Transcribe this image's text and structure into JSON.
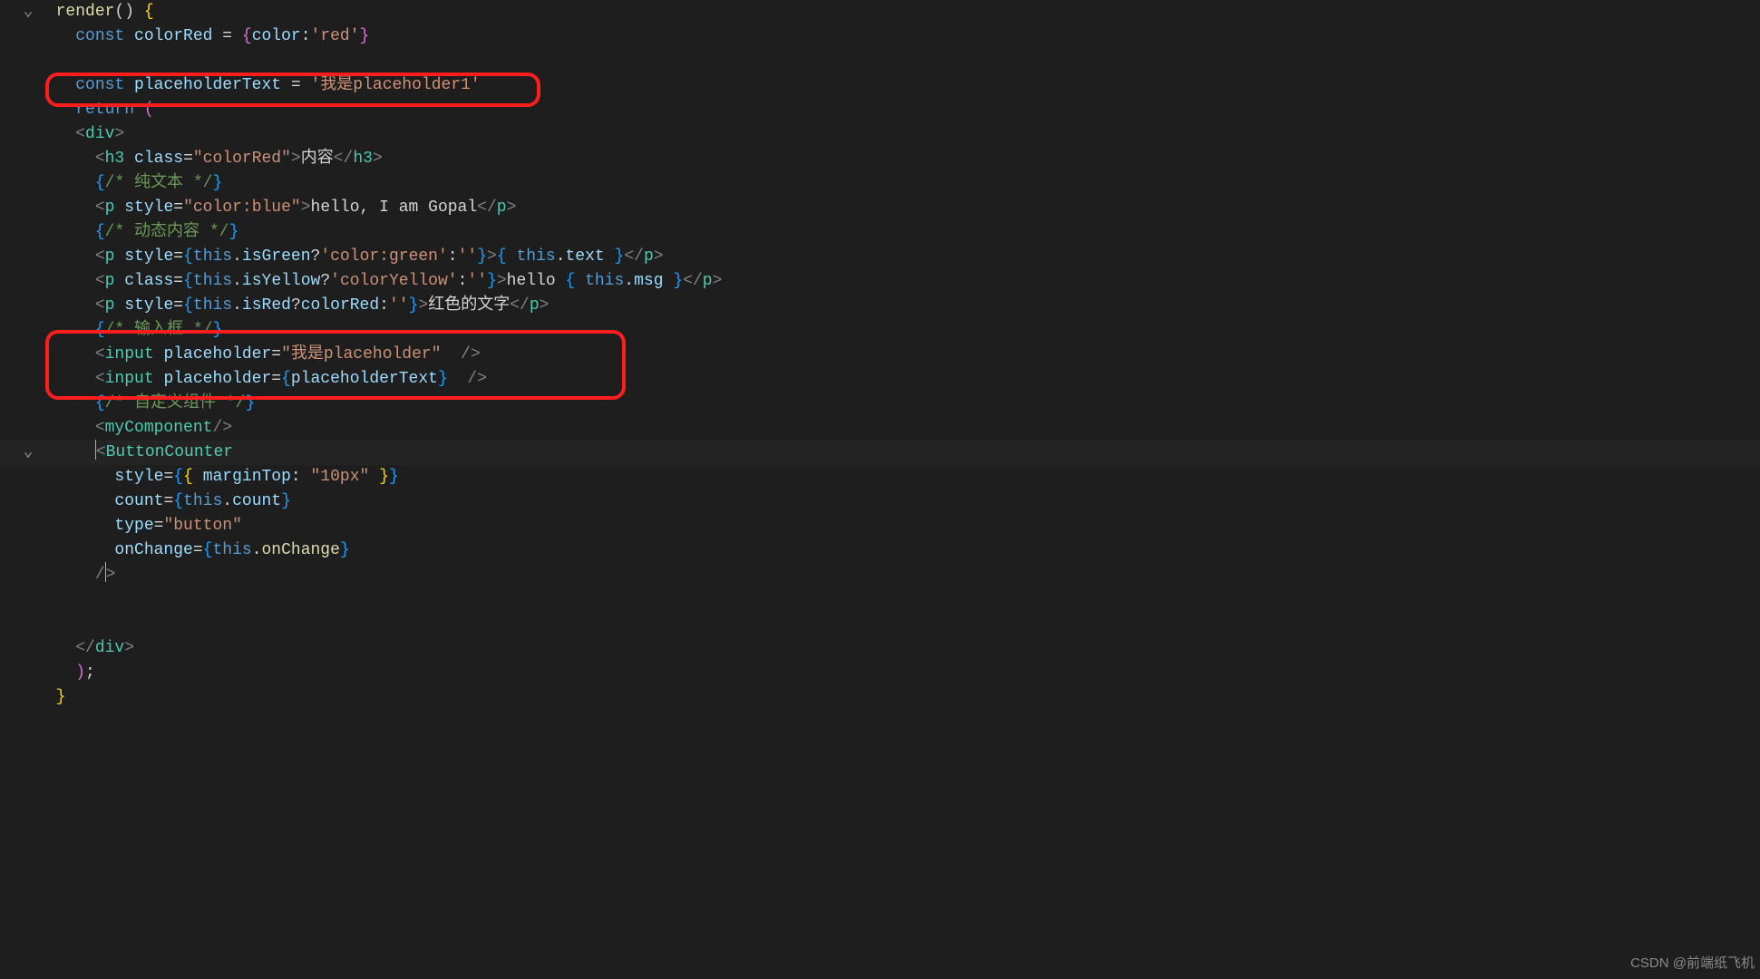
{
  "watermark": "CSDN @前端纸飞机",
  "fold_glyph": "⌄",
  "lines": [
    {
      "fold": true,
      "tokens": [
        [
          "ind",
          "  "
        ],
        [
          "fn",
          "render"
        ],
        [
          "pun",
          "() "
        ],
        [
          "br",
          "{"
        ]
      ]
    },
    {
      "tokens": [
        [
          "ind",
          "    "
        ],
        [
          "kw",
          "const"
        ],
        [
          "pun",
          " "
        ],
        [
          "var",
          "colorRed"
        ],
        [
          "pun",
          " = "
        ],
        [
          "br-p",
          "{"
        ],
        [
          "var",
          "color"
        ],
        [
          "pun",
          ":"
        ],
        [
          "str",
          "'red'"
        ],
        [
          "br-p",
          "}"
        ]
      ]
    },
    {
      "tokens": [
        [
          "pun",
          " "
        ]
      ]
    },
    {
      "tokens": [
        [
          "ind",
          "    "
        ],
        [
          "kw",
          "const"
        ],
        [
          "pun",
          " "
        ],
        [
          "var",
          "placeholderText"
        ],
        [
          "pun",
          " = "
        ],
        [
          "str",
          "'我是placeholder1'"
        ]
      ]
    },
    {
      "tokens": [
        [
          "ind",
          "    "
        ],
        [
          "kw",
          "return"
        ],
        [
          "pun",
          " "
        ],
        [
          "br-p",
          "("
        ]
      ]
    },
    {
      "tokens": [
        [
          "ind",
          "    "
        ],
        [
          "fade",
          "<"
        ],
        [
          "tag",
          "div"
        ],
        [
          "fade",
          ">"
        ]
      ]
    },
    {
      "tokens": [
        [
          "ind",
          "      "
        ],
        [
          "fade",
          "<"
        ],
        [
          "tag",
          "h3"
        ],
        [
          "pun",
          " "
        ],
        [
          "attr",
          "class"
        ],
        [
          "pun",
          "="
        ],
        [
          "str",
          "\"colorRed\""
        ],
        [
          "fade",
          ">"
        ],
        [
          "pun",
          "内容"
        ],
        [
          "fade",
          "</"
        ],
        [
          "tag",
          "h3"
        ],
        [
          "fade",
          ">"
        ]
      ]
    },
    {
      "tokens": [
        [
          "ind",
          "      "
        ],
        [
          "br-b",
          "{"
        ],
        [
          "cmt",
          "/* 纯文本 */"
        ],
        [
          "br-b",
          "}"
        ]
      ]
    },
    {
      "tokens": [
        [
          "ind",
          "      "
        ],
        [
          "fade",
          "<"
        ],
        [
          "tag",
          "p"
        ],
        [
          "pun",
          " "
        ],
        [
          "attr",
          "style"
        ],
        [
          "pun",
          "="
        ],
        [
          "str",
          "\"color:blue\""
        ],
        [
          "fade",
          ">"
        ],
        [
          "pun",
          "hello, I am Gopal"
        ],
        [
          "fade",
          "</"
        ],
        [
          "tag",
          "p"
        ],
        [
          "fade",
          ">"
        ]
      ]
    },
    {
      "tokens": [
        [
          "ind",
          "      "
        ],
        [
          "br-b",
          "{"
        ],
        [
          "cmt",
          "/* 动态内容 */"
        ],
        [
          "br-b",
          "}"
        ]
      ]
    },
    {
      "tokens": [
        [
          "ind",
          "      "
        ],
        [
          "fade",
          "<"
        ],
        [
          "tag",
          "p"
        ],
        [
          "pun",
          " "
        ],
        [
          "attr",
          "style"
        ],
        [
          "pun",
          "="
        ],
        [
          "br-b",
          "{"
        ],
        [
          "kw",
          "this"
        ],
        [
          "pun",
          "."
        ],
        [
          "var",
          "isGreen"
        ],
        [
          "pun",
          "?"
        ],
        [
          "str",
          "'color:green'"
        ],
        [
          "pun",
          ":"
        ],
        [
          "str",
          "''"
        ],
        [
          "br-b",
          "}"
        ],
        [
          "fade",
          ">"
        ],
        [
          "br-b",
          "{"
        ],
        [
          "pun",
          " "
        ],
        [
          "kw",
          "this"
        ],
        [
          "pun",
          "."
        ],
        [
          "var",
          "text"
        ],
        [
          "pun",
          " "
        ],
        [
          "br-b",
          "}"
        ],
        [
          "fade",
          "</"
        ],
        [
          "tag",
          "p"
        ],
        [
          "fade",
          ">"
        ]
      ]
    },
    {
      "tokens": [
        [
          "ind",
          "      "
        ],
        [
          "fade",
          "<"
        ],
        [
          "tag",
          "p"
        ],
        [
          "pun",
          " "
        ],
        [
          "attr",
          "class"
        ],
        [
          "pun",
          "="
        ],
        [
          "br-b",
          "{"
        ],
        [
          "kw",
          "this"
        ],
        [
          "pun",
          "."
        ],
        [
          "var",
          "isYellow"
        ],
        [
          "pun",
          "?"
        ],
        [
          "str",
          "'colorYellow'"
        ],
        [
          "pun",
          ":"
        ],
        [
          "str",
          "''"
        ],
        [
          "br-b",
          "}"
        ],
        [
          "fade",
          ">"
        ],
        [
          "pun",
          "hello "
        ],
        [
          "br-b",
          "{"
        ],
        [
          "pun",
          " "
        ],
        [
          "kw",
          "this"
        ],
        [
          "pun",
          "."
        ],
        [
          "var",
          "msg"
        ],
        [
          "pun",
          " "
        ],
        [
          "br-b",
          "}"
        ],
        [
          "fade",
          "</"
        ],
        [
          "tag",
          "p"
        ],
        [
          "fade",
          ">"
        ]
      ]
    },
    {
      "tokens": [
        [
          "ind",
          "      "
        ],
        [
          "fade",
          "<"
        ],
        [
          "tag",
          "p"
        ],
        [
          "pun",
          " "
        ],
        [
          "attr",
          "style"
        ],
        [
          "pun",
          "="
        ],
        [
          "br-b",
          "{"
        ],
        [
          "kw",
          "this"
        ],
        [
          "pun",
          "."
        ],
        [
          "var",
          "isRed"
        ],
        [
          "pun",
          "?"
        ],
        [
          "var",
          "colorRed"
        ],
        [
          "pun",
          ":"
        ],
        [
          "str",
          "''"
        ],
        [
          "br-b",
          "}"
        ],
        [
          "fade",
          ">"
        ],
        [
          "pun",
          "红色的文字"
        ],
        [
          "fade",
          "</"
        ],
        [
          "tag",
          "p"
        ],
        [
          "fade",
          ">"
        ]
      ]
    },
    {
      "tokens": [
        [
          "ind",
          "      "
        ],
        [
          "br-b",
          "{"
        ],
        [
          "cmt",
          "/* 输入框 */"
        ],
        [
          "br-b",
          "}"
        ]
      ]
    },
    {
      "tokens": [
        [
          "ind",
          "      "
        ],
        [
          "fade",
          "<"
        ],
        [
          "tag",
          "input"
        ],
        [
          "pun",
          " "
        ],
        [
          "attr",
          "placeholder"
        ],
        [
          "pun",
          "="
        ],
        [
          "str",
          "\"我是placeholder\""
        ],
        [
          "pun",
          "  "
        ],
        [
          "fade",
          "/>"
        ]
      ]
    },
    {
      "tokens": [
        [
          "ind",
          "      "
        ],
        [
          "fade",
          "<"
        ],
        [
          "tag",
          "input"
        ],
        [
          "pun",
          " "
        ],
        [
          "attr",
          "placeholder"
        ],
        [
          "pun",
          "="
        ],
        [
          "br-b",
          "{"
        ],
        [
          "var",
          "placeholderText"
        ],
        [
          "br-b",
          "}"
        ],
        [
          "pun",
          "  "
        ],
        [
          "fade",
          "/>"
        ]
      ]
    },
    {
      "tokens": [
        [
          "ind",
          "      "
        ],
        [
          "br-b",
          "{"
        ],
        [
          "cmt",
          "/* 自定义组件 */"
        ],
        [
          "br-b",
          "}"
        ]
      ]
    },
    {
      "tokens": [
        [
          "ind",
          "      "
        ],
        [
          "fade",
          "<"
        ],
        [
          "tag",
          "myComponent"
        ],
        [
          "fade",
          "/>"
        ]
      ]
    },
    {
      "fold": true,
      "cursorBefore": true,
      "highlight": true,
      "tokens": [
        [
          "ind",
          "      "
        ],
        [
          "fade",
          "<"
        ],
        [
          "tag",
          "ButtonCounter"
        ]
      ]
    },
    {
      "tokens": [
        [
          "ind",
          "        "
        ],
        [
          "attr",
          "style"
        ],
        [
          "pun",
          "="
        ],
        [
          "br-b",
          "{"
        ],
        [
          "br-y",
          "{"
        ],
        [
          "pun",
          " "
        ],
        [
          "var",
          "marginTop"
        ],
        [
          "pun",
          ": "
        ],
        [
          "str",
          "\"10px\""
        ],
        [
          "pun",
          " "
        ],
        [
          "br-y",
          "}"
        ],
        [
          "br-b",
          "}"
        ]
      ]
    },
    {
      "tokens": [
        [
          "ind",
          "        "
        ],
        [
          "attr",
          "count"
        ],
        [
          "pun",
          "="
        ],
        [
          "br-b",
          "{"
        ],
        [
          "kw",
          "this"
        ],
        [
          "pun",
          "."
        ],
        [
          "var",
          "count"
        ],
        [
          "br-b",
          "}"
        ]
      ]
    },
    {
      "tokens": [
        [
          "ind",
          "        "
        ],
        [
          "attr",
          "type"
        ],
        [
          "pun",
          "="
        ],
        [
          "str",
          "\"button\""
        ]
      ]
    },
    {
      "tokens": [
        [
          "ind",
          "        "
        ],
        [
          "attr",
          "onChange"
        ],
        [
          "pun",
          "="
        ],
        [
          "br-b",
          "{"
        ],
        [
          "kw",
          "this"
        ],
        [
          "pun",
          "."
        ],
        [
          "fn",
          "onChange"
        ],
        [
          "br-b",
          "}"
        ]
      ]
    },
    {
      "cursorAfterSlash": true,
      "tokens": [
        [
          "ind",
          "      "
        ],
        [
          "fade",
          "/"
        ],
        [
          "fade",
          ">"
        ]
      ]
    },
    {
      "tokens": [
        [
          "pun",
          " "
        ]
      ]
    },
    {
      "tokens": [
        [
          "pun",
          " "
        ]
      ]
    },
    {
      "tokens": [
        [
          "ind",
          "    "
        ],
        [
          "fade",
          "</"
        ],
        [
          "tag",
          "div"
        ],
        [
          "fade",
          ">"
        ]
      ]
    },
    {
      "tokens": [
        [
          "ind",
          "    "
        ],
        [
          "br-p",
          ")"
        ],
        [
          "pun",
          ";"
        ]
      ]
    },
    {
      "tokens": [
        [
          "ind",
          "  "
        ],
        [
          "br",
          "}"
        ]
      ]
    }
  ]
}
